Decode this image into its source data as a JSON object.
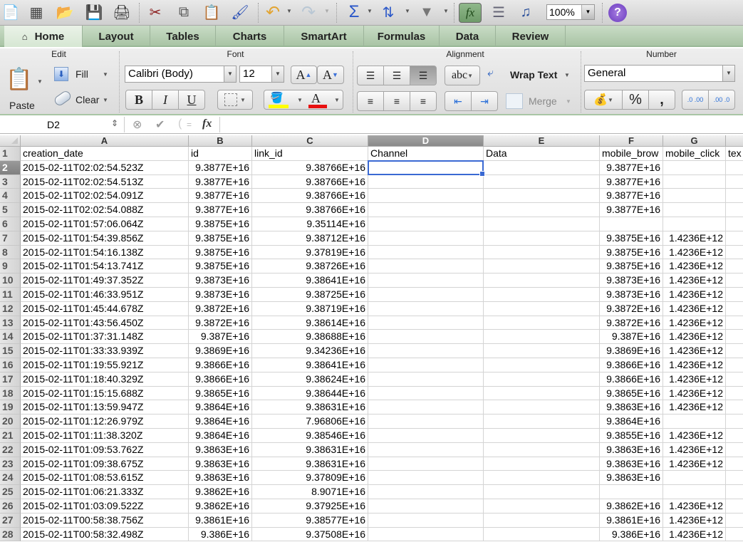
{
  "toolbar": {
    "icons": [
      {
        "name": "new-document-icon",
        "glyph": "📄"
      },
      {
        "name": "template-gallery-icon",
        "glyph": "▦"
      },
      {
        "name": "open-folder-icon",
        "glyph": "📂"
      },
      {
        "name": "save-icon",
        "glyph": "💾"
      },
      {
        "name": "print-icon",
        "glyph": "🖨"
      },
      {
        "name": "cut-icon",
        "glyph": "✂"
      },
      {
        "name": "copy-icon",
        "glyph": "⧉"
      },
      {
        "name": "paste-icon",
        "glyph": "📋"
      },
      {
        "name": "format-painter-icon",
        "glyph": "🖌"
      },
      {
        "name": "undo-icon",
        "glyph": "↶"
      },
      {
        "name": "redo-icon",
        "glyph": "↷"
      },
      {
        "name": "autosum-icon",
        "glyph": "Σ"
      },
      {
        "name": "sort-icon",
        "glyph": "⇅"
      },
      {
        "name": "filter-icon",
        "glyph": "▼"
      },
      {
        "name": "formula-builder-icon",
        "glyph": "fx"
      },
      {
        "name": "show-hide-gallery-icon",
        "glyph": "☰"
      },
      {
        "name": "media-browser-icon",
        "glyph": "♫"
      },
      {
        "name": "help-icon",
        "glyph": "?"
      }
    ],
    "zoom_value": "100%"
  },
  "tabs": [
    {
      "label": "Home",
      "active": true
    },
    {
      "label": "Layout",
      "active": false
    },
    {
      "label": "Tables",
      "active": false
    },
    {
      "label": "Charts",
      "active": false
    },
    {
      "label": "SmartArt",
      "active": false
    },
    {
      "label": "Formulas",
      "active": false
    },
    {
      "label": "Data",
      "active": false
    },
    {
      "label": "Review",
      "active": false
    }
  ],
  "ribbon": {
    "groups": {
      "edit": "Edit",
      "font": "Font",
      "alignment": "Alignment",
      "number": "Number"
    },
    "paste_label": "Paste",
    "fill_label": "Fill",
    "clear_label": "Clear",
    "font_name": "Calibri (Body)",
    "font_size": "12",
    "grow_font": "A",
    "shrink_font": "A",
    "bold": "B",
    "italic": "I",
    "underline": "U",
    "highlight_color": "#ffff00",
    "font_color": "#e81010",
    "orientation_label": "abc",
    "wrap_text_label": "Wrap Text",
    "merge_label": "Merge",
    "number_format": "General",
    "percent_label": "%",
    "comma_label": ",",
    "inc_decimal_label": ".0 .00",
    "dec_decimal_label": ".00 .0"
  },
  "formula_bar": {
    "name_box": "D2",
    "fx_label": "fx",
    "formula": ""
  },
  "sheet": {
    "columns": [
      "A",
      "B",
      "C",
      "D",
      "E",
      "F",
      "G",
      ""
    ],
    "selected_column": "D",
    "selected_row": "2",
    "rows": [
      {
        "n": "1",
        "cells": [
          "creation_date",
          "id",
          "link_id",
          "Channel",
          "Data",
          "mobile_brow",
          "mobile_click",
          "tex"
        ]
      },
      {
        "n": "2",
        "cells": [
          "2015-02-11T02:02:54.523Z",
          "9.3877E+16",
          "9.38766E+16",
          "",
          "",
          "9.3877E+16",
          "",
          ""
        ]
      },
      {
        "n": "3",
        "cells": [
          "2015-02-11T02:02:54.513Z",
          "9.3877E+16",
          "9.38766E+16",
          "",
          "",
          "9.3877E+16",
          "",
          ""
        ]
      },
      {
        "n": "4",
        "cells": [
          "2015-02-11T02:02:54.091Z",
          "9.3877E+16",
          "9.38766E+16",
          "",
          "",
          "9.3877E+16",
          "",
          ""
        ]
      },
      {
        "n": "5",
        "cells": [
          "2015-02-11T02:02:54.088Z",
          "9.3877E+16",
          "9.38766E+16",
          "",
          "",
          "9.3877E+16",
          "",
          ""
        ]
      },
      {
        "n": "6",
        "cells": [
          "2015-02-11T01:57:06.064Z",
          "9.3875E+16",
          "9.35114E+16",
          "",
          "",
          "",
          "",
          ""
        ]
      },
      {
        "n": "7",
        "cells": [
          "2015-02-11T01:54:39.856Z",
          "9.3875E+16",
          "9.38712E+16",
          "",
          "",
          "9.3875E+16",
          "1.4236E+12",
          ""
        ]
      },
      {
        "n": "8",
        "cells": [
          "2015-02-11T01:54:16.138Z",
          "9.3875E+16",
          "9.37819E+16",
          "",
          "",
          "9.3875E+16",
          "1.4236E+12",
          ""
        ]
      },
      {
        "n": "9",
        "cells": [
          "2015-02-11T01:54:13.741Z",
          "9.3875E+16",
          "9.38726E+16",
          "",
          "",
          "9.3875E+16",
          "1.4236E+12",
          ""
        ]
      },
      {
        "n": "10",
        "cells": [
          "2015-02-11T01:49:37.352Z",
          "9.3873E+16",
          "9.38641E+16",
          "",
          "",
          "9.3873E+16",
          "1.4236E+12",
          ""
        ]
      },
      {
        "n": "11",
        "cells": [
          "2015-02-11T01:46:33.951Z",
          "9.3873E+16",
          "9.38725E+16",
          "",
          "",
          "9.3873E+16",
          "1.4236E+12",
          ""
        ]
      },
      {
        "n": "12",
        "cells": [
          "2015-02-11T01:45:44.678Z",
          "9.3872E+16",
          "9.38719E+16",
          "",
          "",
          "9.3872E+16",
          "1.4236E+12",
          ""
        ]
      },
      {
        "n": "13",
        "cells": [
          "2015-02-11T01:43:56.450Z",
          "9.3872E+16",
          "9.38614E+16",
          "",
          "",
          "9.3872E+16",
          "1.4236E+12",
          ""
        ]
      },
      {
        "n": "14",
        "cells": [
          "2015-02-11T01:37:31.148Z",
          "9.387E+16",
          "9.38688E+16",
          "",
          "",
          "9.387E+16",
          "1.4236E+12",
          ""
        ]
      },
      {
        "n": "15",
        "cells": [
          "2015-02-11T01:33:33.939Z",
          "9.3869E+16",
          "9.34236E+16",
          "",
          "",
          "9.3869E+16",
          "1.4236E+12",
          ""
        ]
      },
      {
        "n": "16",
        "cells": [
          "2015-02-11T01:19:55.921Z",
          "9.3866E+16",
          "9.38641E+16",
          "",
          "",
          "9.3866E+16",
          "1.4236E+12",
          ""
        ]
      },
      {
        "n": "17",
        "cells": [
          "2015-02-11T01:18:40.329Z",
          "9.3866E+16",
          "9.38624E+16",
          "",
          "",
          "9.3866E+16",
          "1.4236E+12",
          ""
        ]
      },
      {
        "n": "18",
        "cells": [
          "2015-02-11T01:15:15.688Z",
          "9.3865E+16",
          "9.38644E+16",
          "",
          "",
          "9.3865E+16",
          "1.4236E+12",
          ""
        ]
      },
      {
        "n": "19",
        "cells": [
          "2015-02-11T01:13:59.947Z",
          "9.3864E+16",
          "9.38631E+16",
          "",
          "",
          "9.3863E+16",
          "1.4236E+12",
          ""
        ]
      },
      {
        "n": "20",
        "cells": [
          "2015-02-11T01:12:26.979Z",
          "9.3864E+16",
          "7.96806E+16",
          "",
          "",
          "9.3864E+16",
          "",
          ""
        ]
      },
      {
        "n": "21",
        "cells": [
          "2015-02-11T01:11:38.320Z",
          "9.3864E+16",
          "9.38546E+16",
          "",
          "",
          "9.3855E+16",
          "1.4236E+12",
          ""
        ]
      },
      {
        "n": "22",
        "cells": [
          "2015-02-11T01:09:53.762Z",
          "9.3863E+16",
          "9.38631E+16",
          "",
          "",
          "9.3863E+16",
          "1.4236E+12",
          ""
        ]
      },
      {
        "n": "23",
        "cells": [
          "2015-02-11T01:09:38.675Z",
          "9.3863E+16",
          "9.38631E+16",
          "",
          "",
          "9.3863E+16",
          "1.4236E+12",
          ""
        ]
      },
      {
        "n": "24",
        "cells": [
          "2015-02-11T01:08:53.615Z",
          "9.3863E+16",
          "9.37809E+16",
          "",
          "",
          "9.3863E+16",
          "",
          ""
        ]
      },
      {
        "n": "25",
        "cells": [
          "2015-02-11T01:06:21.333Z",
          "9.3862E+16",
          "8.9071E+16",
          "",
          "",
          "",
          "",
          ""
        ]
      },
      {
        "n": "26",
        "cells": [
          "2015-02-11T01:03:09.522Z",
          "9.3862E+16",
          "9.37925E+16",
          "",
          "",
          "9.3862E+16",
          "1.4236E+12",
          ""
        ]
      },
      {
        "n": "27",
        "cells": [
          "2015-02-11T00:58:38.756Z",
          "9.3861E+16",
          "9.38577E+16",
          "",
          "",
          "9.3861E+16",
          "1.4236E+12",
          ""
        ]
      },
      {
        "n": "28",
        "cells": [
          "2015-02-11T00:58:32.498Z",
          "9.386E+16",
          "9.37508E+16",
          "",
          "",
          "9.386E+16",
          "1.4236E+12",
          ""
        ]
      }
    ]
  }
}
